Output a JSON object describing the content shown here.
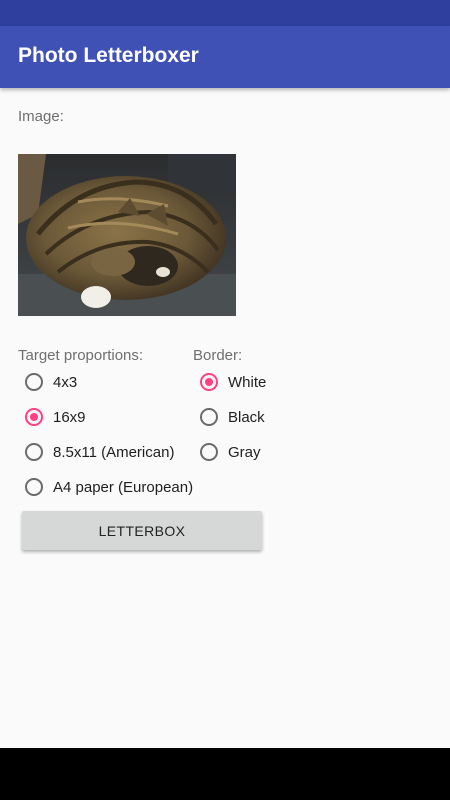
{
  "app": {
    "title": "Photo Letterboxer"
  },
  "image_section": {
    "label": "Image:"
  },
  "proportions": {
    "label": "Target proportions:",
    "options": [
      {
        "label": "4x3",
        "checked": false
      },
      {
        "label": "16x9",
        "checked": true
      },
      {
        "label": "8.5x11 (American)",
        "checked": false
      },
      {
        "label": "A4 paper (European)",
        "checked": false
      }
    ]
  },
  "border": {
    "label": "Border:",
    "options": [
      {
        "label": "White",
        "checked": true
      },
      {
        "label": "Black",
        "checked": false
      },
      {
        "label": "Gray",
        "checked": false
      }
    ]
  },
  "action": {
    "button_label": "LETTERBOX"
  },
  "colors": {
    "status_bar": "#2f3f9e",
    "app_bar": "#3f51b5",
    "accent": "#ff4081",
    "background": "#fafafa",
    "button": "#d6d7d7"
  }
}
